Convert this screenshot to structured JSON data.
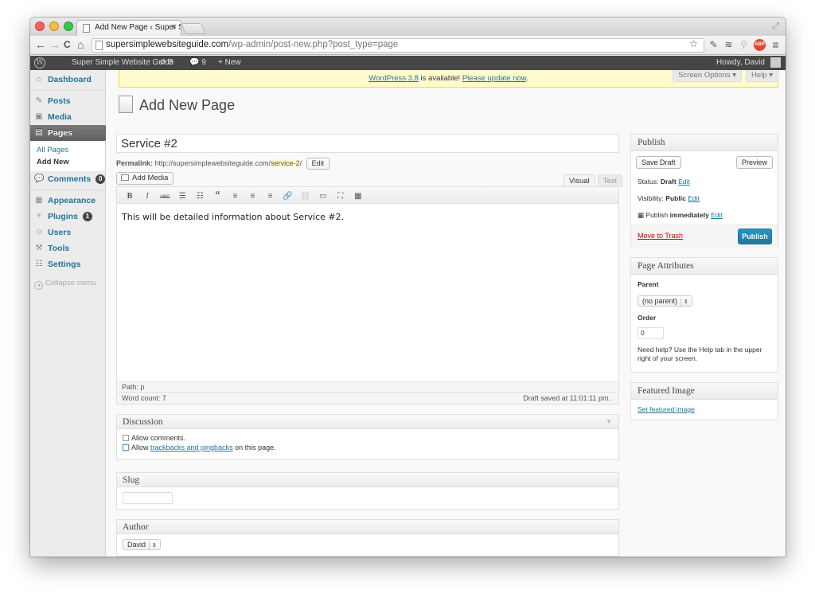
{
  "browser": {
    "tab_title": "Add New Page ‹ Super Simp",
    "tab_close": "×",
    "url_host": "supersimplewebsiteguide.com",
    "url_path": "/wp-admin/post-new.php?post_type=page",
    "back": "←",
    "forward": "→",
    "reload": "C",
    "home": "⌂",
    "star": "☆",
    "ext1": "✎",
    "ext2": "≋",
    "ext3": "⚲",
    "ext_abp": "ABP",
    "menu": "≡",
    "fullscreen": "⤢"
  },
  "adminbar": {
    "wp_logo": "W",
    "site_name": "Super Simple Website Guide",
    "updates_count": "⟳ 5",
    "comments_count": "💬 9",
    "new_label": "+ New",
    "howdy": "Howdy, David"
  },
  "sidebar": {
    "dashboard": "Dashboard",
    "posts": "Posts",
    "media": "Media",
    "pages": "Pages",
    "all_pages": "All Pages",
    "add_new": "Add New",
    "comments": "Comments",
    "comments_badge": "0",
    "appearance": "Appearance",
    "plugins": "Plugins",
    "plugins_badge": "1",
    "users": "Users",
    "tools": "Tools",
    "settings": "Settings",
    "collapse": "Collapse menu"
  },
  "notice": {
    "version_link": "WordPress 3.8",
    "middle": " is available! ",
    "update_link": "Please update now",
    "end": "."
  },
  "screen_tabs": {
    "screen_options": "Screen Options ▾",
    "help": "Help ▾"
  },
  "page": {
    "heading": "Add New Page",
    "title_value": "Service #2",
    "permalink_label": "Permalink:",
    "permalink_base": " http://supersimplewebsiteguide.com/",
    "permalink_slug": "service-2",
    "permalink_end": "/",
    "edit_button": "Edit"
  },
  "editor": {
    "add_media": "Add Media",
    "tab_visual": "Visual",
    "tab_text": "Text",
    "toolbar": [
      "B",
      "I",
      "ABC",
      "☰",
      "☷",
      "“",
      "≡",
      "≡",
      "≡",
      "🔗",
      "⛓",
      "▭",
      "⛶",
      "▦"
    ],
    "content": "This will be detailed information about Service #2.",
    "path": "Path: p",
    "word_count": "Word count: 7",
    "draft_saved": "Draft saved at 11:01:11 pm."
  },
  "discussion": {
    "title": "Discussion",
    "arrow": "▼",
    "allow_comments": "Allow comments.",
    "allow_prefix": "Allow ",
    "trackbacks_link": "trackbacks and pingbacks",
    "allow_suffix": " on this page."
  },
  "slug_box": {
    "title": "Slug",
    "value": ""
  },
  "author_box": {
    "title": "Author",
    "selected": "David"
  },
  "publish": {
    "title": "Publish",
    "save_draft": "Save Draft",
    "preview": "Preview",
    "status_label": "Status:",
    "status_value": "Draft",
    "visibility_label": "Visibility:",
    "visibility_value": "Public",
    "publish_label": "Publish",
    "publish_when": "immediately",
    "edit": "Edit",
    "move_to_trash": "Move to Trash",
    "publish_button": "Publish"
  },
  "page_attributes": {
    "title": "Page Attributes",
    "parent_label": "Parent",
    "parent_selected": "(no parent)",
    "order_label": "Order",
    "order_value": "0",
    "help_text": "Need help? Use the Help tab in the upper right of your screen."
  },
  "featured_image": {
    "title": "Featured Image",
    "link": "Set featured image"
  }
}
